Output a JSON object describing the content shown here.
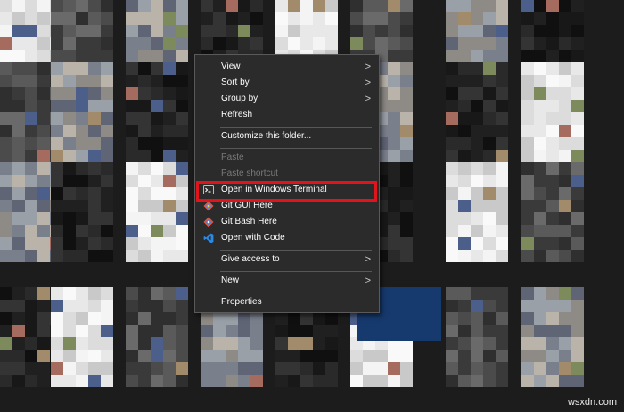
{
  "context_menu": {
    "items": [
      {
        "label": "View",
        "submenu": true
      },
      {
        "label": "Sort by",
        "submenu": true
      },
      {
        "label": "Group by",
        "submenu": true
      },
      {
        "label": "Refresh",
        "submenu": false
      },
      {
        "label": "Customize this folder...",
        "submenu": false
      },
      {
        "label": "Paste",
        "disabled": true
      },
      {
        "label": "Paste shortcut",
        "disabled": true
      },
      {
        "label": "Open in Windows Terminal",
        "icon": "terminal-icon",
        "highlighted": true
      },
      {
        "label": "Git GUI Here",
        "icon": "git-gui-icon"
      },
      {
        "label": "Git Bash Here",
        "icon": "git-bash-icon"
      },
      {
        "label": "Open with Code",
        "icon": "vscode-icon"
      },
      {
        "label": "Give access to",
        "submenu": true
      },
      {
        "label": "New",
        "submenu": true
      },
      {
        "label": "Properties",
        "submenu": false
      }
    ],
    "submenu_glyph": ">",
    "highlight_color": "#e1141b",
    "background_color": "#2b2b2b"
  },
  "watermark": "wsxdn.com"
}
